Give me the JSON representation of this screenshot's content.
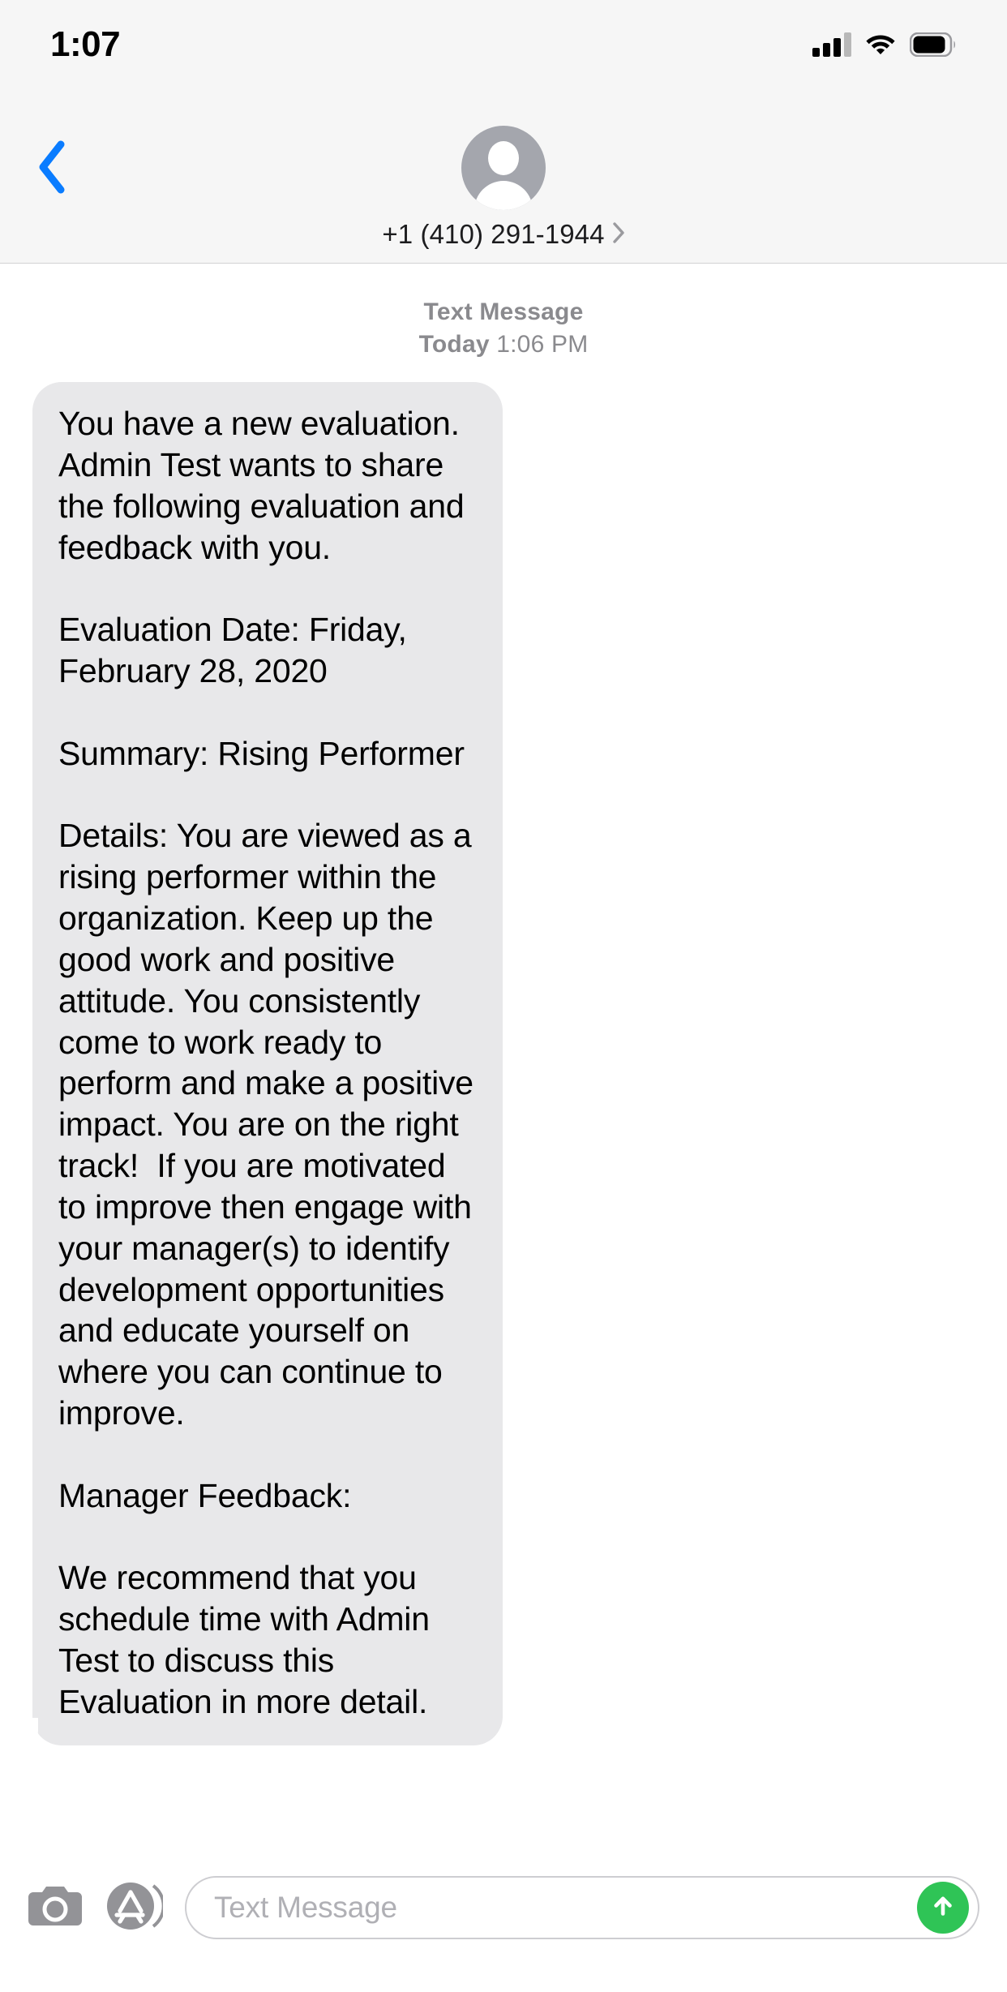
{
  "status_bar": {
    "time": "1:07",
    "signal_icon": "cellular-signal-icon",
    "signal_bars_filled": 3,
    "signal_bars_total": 4,
    "wifi_icon": "wifi-icon",
    "battery_icon": "battery-icon",
    "battery_level_percent": 85
  },
  "nav_header": {
    "back_icon": "chevron-left-icon",
    "avatar_icon": "contact-avatar-placeholder-icon",
    "contact_name": "+1 (410) 291-1944",
    "detail_chevron_icon": "chevron-right-icon"
  },
  "conversation": {
    "timestamp_label": "Text Message",
    "timestamp_day": "Today",
    "timestamp_time": "1:06 PM",
    "messages": [
      {
        "sender": "incoming",
        "text": "You have a new evaluation. Admin Test wants to share the following evaluation and feedback with you.\n\nEvaluation Date: Friday, February 28, 2020\n\nSummary: Rising Performer\n\nDetails: You are viewed as a rising performer within the organization. Keep up the good work and positive attitude. You consistently come to work ready to perform and make a positive impact. You are on the right track!  If you are motivated to improve then engage with your manager(s) to identify development opportunities and educate yourself on where you can continue to improve.\n\nManager Feedback:\n\nWe recommend that you schedule time with Admin Test to discuss this Evaluation in more detail."
      }
    ]
  },
  "input_bar": {
    "camera_icon": "camera-icon",
    "appstore_icon": "app-store-icon",
    "placeholder": "Text Message",
    "value": "",
    "send_icon": "arrow-up-icon",
    "send_color": "#2fc456"
  }
}
